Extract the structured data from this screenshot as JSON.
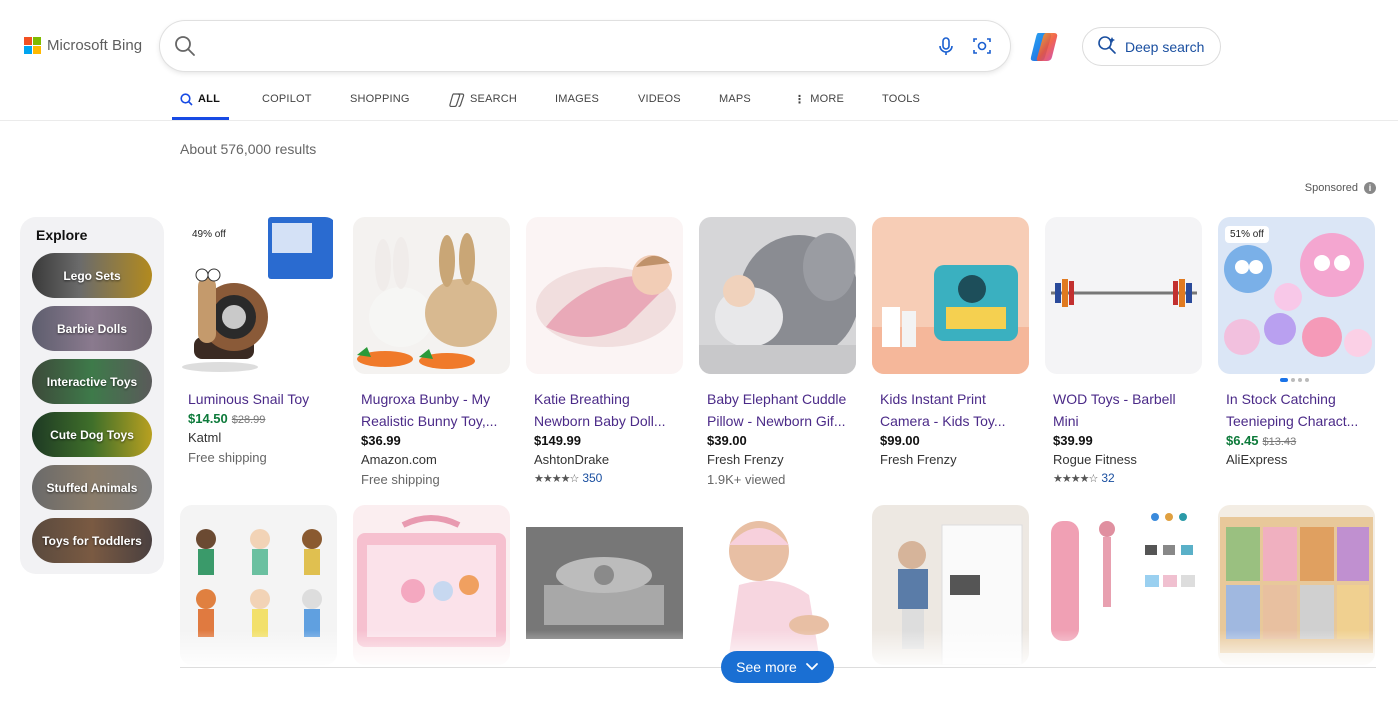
{
  "brand": {
    "name": "Microsoft Bing",
    "colors": [
      "#f25022",
      "#7fba00",
      "#00a4ef",
      "#ffb900"
    ]
  },
  "search": {
    "value": "",
    "placeholder": ""
  },
  "deep_search": {
    "label": "Deep search"
  },
  "tabs": [
    {
      "label": "ALL",
      "icon": "search-icon",
      "active": true
    },
    {
      "label": "COPILOT"
    },
    {
      "label": "SHOPPING"
    },
    {
      "label": "SEARCH",
      "icon": "copilot-search-icon"
    },
    {
      "label": "IMAGES"
    },
    {
      "label": "VIDEOS"
    },
    {
      "label": "MAPS"
    },
    {
      "label": "MORE",
      "icon": "more-vertical-icon"
    },
    {
      "label": "TOOLS"
    }
  ],
  "results_count": "About 576,000 results",
  "sponsored": {
    "label": "Sponsored",
    "icon": "info-icon"
  },
  "explore": {
    "title": "Explore",
    "chips": [
      "Lego Sets",
      "Barbie Dolls",
      "Interactive Toys",
      "Cute Dog Toys",
      "Stuffed Animals",
      "Toys for Toddlers"
    ]
  },
  "products": [
    {
      "badge": "49% off",
      "title1": "Luminous Snail Toy",
      "title2": "",
      "price": "$14.50",
      "orig": "$28.99",
      "seller": "Katml",
      "extra": "Free shipping",
      "rating": ""
    },
    {
      "badge": "",
      "title1": "Mugroxa Bunby - My",
      "title2": "Realistic Bunny Toy,...",
      "price": "$36.99",
      "orig": "",
      "seller": "Amazon.com",
      "extra": "Free shipping",
      "rating": ""
    },
    {
      "badge": "",
      "title1": "Katie Breathing",
      "title2": "Newborn Baby Doll...",
      "price": "$149.99",
      "orig": "",
      "seller": "AshtonDrake",
      "extra": "",
      "rating": "350"
    },
    {
      "badge": "",
      "title1": "Baby Elephant Cuddle",
      "title2": "Pillow - Newborn Gif...",
      "price": "$39.00",
      "orig": "",
      "seller": "Fresh Frenzy",
      "extra": "1.9K+ viewed",
      "rating": ""
    },
    {
      "badge": "",
      "title1": "Kids Instant Print",
      "title2": "Camera - Kids Toy...",
      "price": "$99.00",
      "orig": "",
      "seller": "Fresh Frenzy",
      "extra": "",
      "rating": ""
    },
    {
      "badge": "",
      "title1": "WOD Toys - Barbell",
      "title2": "Mini",
      "price": "$39.99",
      "orig": "",
      "seller": "Rogue Fitness",
      "extra": "",
      "rating": "32"
    },
    {
      "badge": "51% off",
      "title1": "In Stock Catching",
      "title2": "Teenieping Charact...",
      "price": "$6.45",
      "orig": "$13.43",
      "seller": "AliExpress",
      "extra": "",
      "rating": ""
    }
  ],
  "see_more": {
    "label": "See more"
  }
}
